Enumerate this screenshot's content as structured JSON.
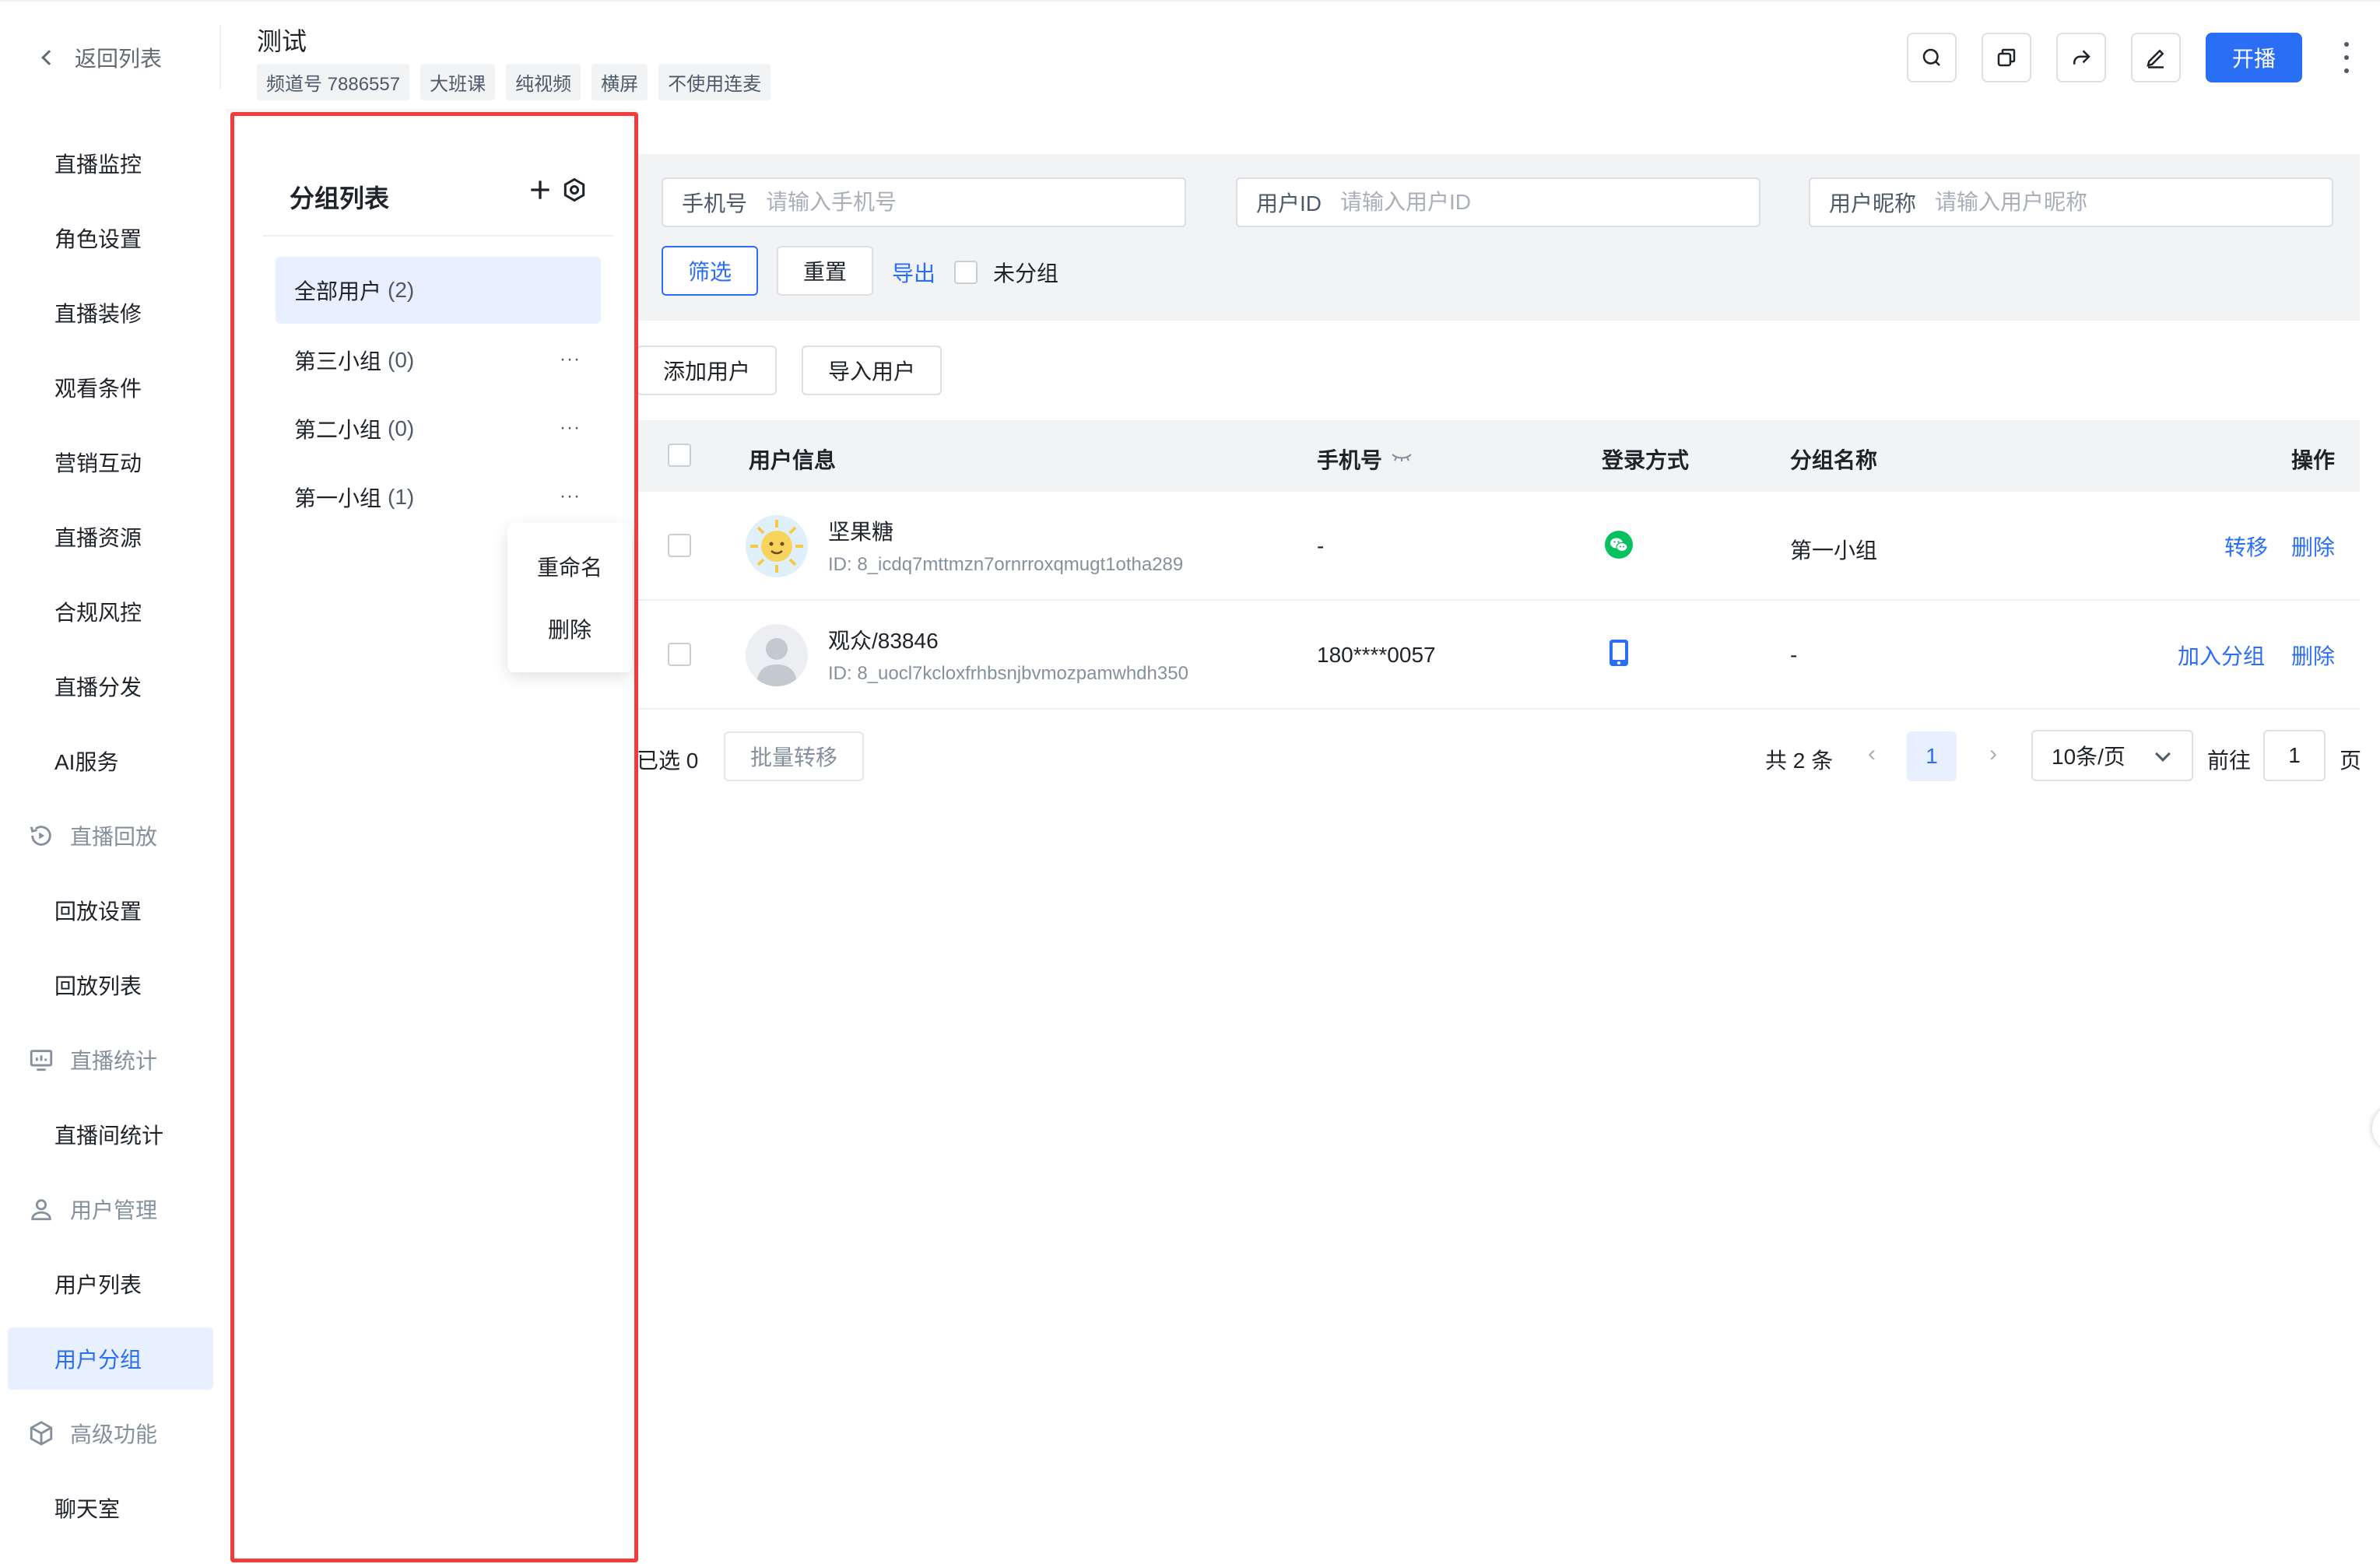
{
  "header": {
    "back_label": "返回列表",
    "title": "测试",
    "tags": [
      "频道号 7886557",
      "大班课",
      "纯视频",
      "横屏",
      "不使用连麦"
    ],
    "toolbar_icons": [
      "search-icon",
      "copy-icon",
      "share-icon",
      "edit-icon"
    ],
    "start_label": "开播",
    "accent_color": "#2b6ef6"
  },
  "sidebar": {
    "items": [
      {
        "label": "直播监控",
        "type": "item"
      },
      {
        "label": "角色设置",
        "type": "item"
      },
      {
        "label": "直播装修",
        "type": "item"
      },
      {
        "label": "观看条件",
        "type": "item"
      },
      {
        "label": "营销互动",
        "type": "item"
      },
      {
        "label": "直播资源",
        "type": "item"
      },
      {
        "label": "合规风控",
        "type": "item"
      },
      {
        "label": "直播分发",
        "type": "item"
      },
      {
        "label": "AI服务",
        "type": "item"
      },
      {
        "label": "直播回放",
        "type": "group",
        "icon": "replay-icon"
      },
      {
        "label": "回放设置",
        "type": "item"
      },
      {
        "label": "回放列表",
        "type": "item"
      },
      {
        "label": "直播统计",
        "type": "group",
        "icon": "chart-icon"
      },
      {
        "label": "直播间统计",
        "type": "item"
      },
      {
        "label": "用户管理",
        "type": "group",
        "icon": "user-icon"
      },
      {
        "label": "用户列表",
        "type": "item"
      },
      {
        "label": "用户分组",
        "type": "item",
        "active": true
      },
      {
        "label": "高级功能",
        "type": "group",
        "icon": "cube-icon"
      },
      {
        "label": "聊天室",
        "type": "item"
      }
    ]
  },
  "groups_panel": {
    "title": "分组列表",
    "items": [
      {
        "label": "全部用户",
        "count": "(2)",
        "active": true
      },
      {
        "label": "第三小组",
        "count": "(0)"
      },
      {
        "label": "第二小组",
        "count": "(0)"
      },
      {
        "label": "第一小组",
        "count": "(1)"
      }
    ],
    "more_glyph": "···",
    "context_menu": [
      "重命名",
      "删除"
    ]
  },
  "filter": {
    "phone_label": "手机号",
    "phone_placeholder": "请输入手机号",
    "userid_label": "用户ID",
    "userid_placeholder": "请输入用户ID",
    "nickname_label": "用户昵称",
    "nickname_placeholder": "请输入用户昵称",
    "filter_btn": "筛选",
    "reset_btn": "重置",
    "export_link": "导出",
    "ungrouped_label": "未分组"
  },
  "actions": {
    "add_user": "添加用户",
    "import_user": "导入用户"
  },
  "table": {
    "columns": [
      "用户信息",
      "手机号",
      "登录方式",
      "分组名称",
      "操作"
    ],
    "rows": [
      {
        "name": "坚果糖",
        "id": "ID: 8_icdq7mttmzn7ornrroxqmugt1otha289",
        "phone": "-",
        "login": "wechat-icon",
        "group": "第一小组",
        "ops": [
          "转移",
          "删除"
        ],
        "avatar": "sun-avatar"
      },
      {
        "name": "观众/83846",
        "id": "ID: 8_uocl7kcloxfrhbsnjbvmozpamwhdh350",
        "phone": "180****0057",
        "login": "mobile-icon",
        "group": "-",
        "ops": [
          "加入分组",
          "删除"
        ],
        "avatar": "default-avatar"
      }
    ]
  },
  "pager": {
    "selected": "已选 0",
    "bulk_move": "批量转移",
    "total": "共 2 条",
    "prev": "‹",
    "current": "1",
    "next": "›",
    "page_size": "10条/页",
    "goto_label": "前往",
    "goto_value": "1",
    "page_suffix": "页"
  }
}
